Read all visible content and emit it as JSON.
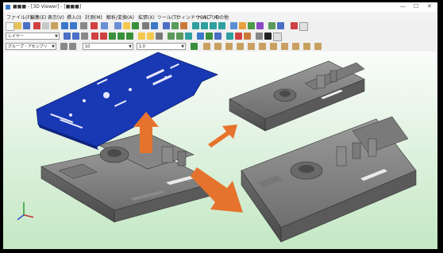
{
  "window": {
    "title": "■■■ - [3D Viewer] - [■■■]",
    "controls": [
      "—",
      "☐",
      "✕"
    ]
  },
  "menu": [
    "ファイル(F)",
    "編集(E)",
    "表示(V)",
    "挿入(I)",
    "計測(M)",
    "解析/変換(A)",
    "拡張(X)",
    "ツール(T)",
    "ウィンドウ(W)",
    "ヘルプ(H)",
    "その他"
  ],
  "toolbar3": {
    "layer_select": "レイヤー",
    "group_select": "グループ・アセンブリ",
    "value_select_1": "10",
    "value_select_2": "1.0"
  },
  "colors": {
    "viewport_top": "#fafdfa",
    "viewport_bottom": "#c4e8c4",
    "part_fill": "#7d7d7d",
    "sheet_fill": "#1838b4",
    "arrow_fill": "#e6732d"
  },
  "icons": {
    "axis_triad": "axis-triad-icon"
  }
}
